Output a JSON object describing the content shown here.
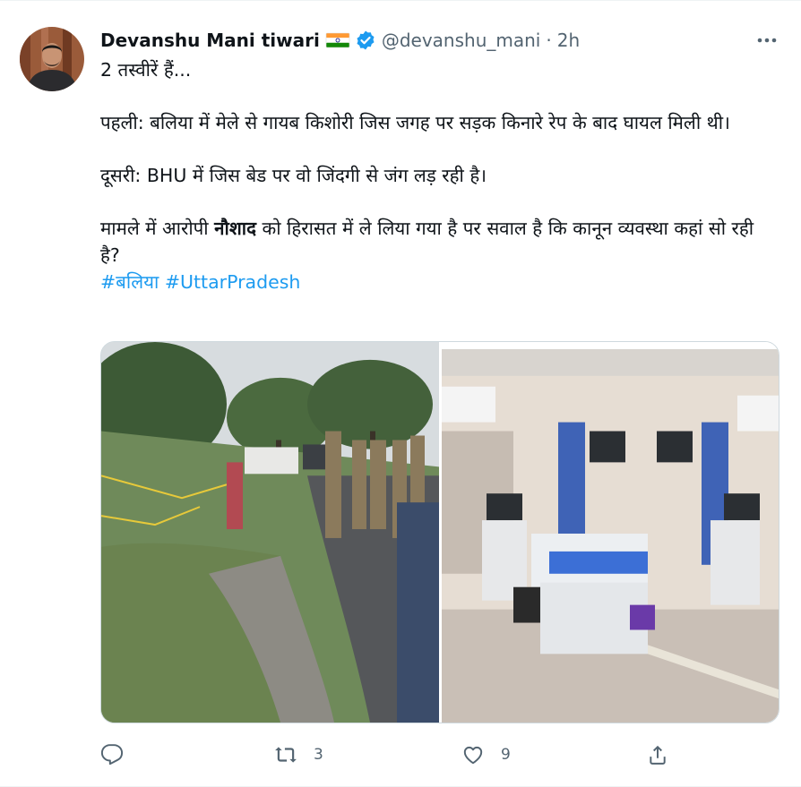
{
  "tweet": {
    "author": {
      "display_name": "Devanshu Mani tiwari",
      "handle": "@devanshu_mani",
      "separator": "·",
      "time": "2h",
      "flag_icon": "india-flag-icon",
      "verified_icon": "verified-badge-icon"
    },
    "text": {
      "line1": "2 तस्वीरें हैं...",
      "para2": "पहली: बलिया में मेले से गायब किशोरी जिस जगह पर सड़क किनारे रेप के बाद घायल मिली थी।",
      "para3": "दूसरी: BHU में जिस बेड पर वो जिंदगी से जंग लड़ रही है।",
      "para4_before": "मामले में आरोपी ",
      "para4_bold": "नौशाद",
      "para4_after": " को हिरासत में ले लिया गया है पर सवाल है कि कानून व्यवस्था कहां सो रही है?",
      "hashtags": [
        "#बलिया",
        "#UttarPradesh"
      ]
    },
    "actions": {
      "reply_count": "",
      "retweet_count": "3",
      "like_count": "9"
    },
    "colors": {
      "link": "#1d9bf0",
      "secondary": "#536471",
      "verified": "#1d9bf0"
    }
  }
}
